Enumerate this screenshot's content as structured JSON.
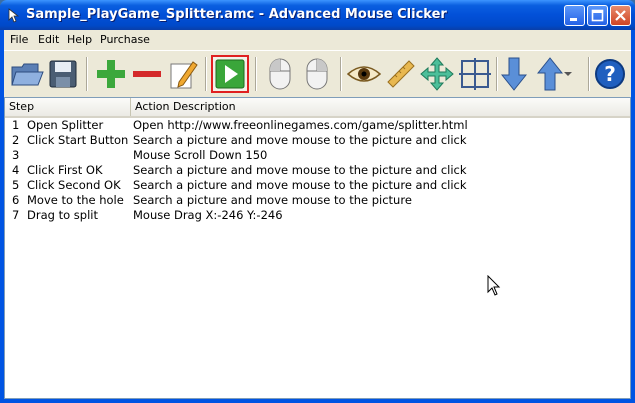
{
  "window": {
    "title": "Sample_PlayGame_Splitter.amc - Advanced Mouse Clicker"
  },
  "menu": [
    "File",
    "Edit",
    "Help",
    "Purchase"
  ],
  "toolbar": {
    "tools": [
      "open-icon",
      "save-icon",
      "add-icon",
      "remove-icon",
      "edit-icon",
      "play-icon",
      "mouse-left-icon",
      "mouse-right-icon",
      "eye-icon",
      "ruler-icon",
      "move-icon",
      "crosshair-icon",
      "down-arrow-icon",
      "up-arrow-icon",
      "dropdown-icon",
      "help-icon"
    ],
    "active_tool": "play-icon"
  },
  "table": {
    "columns": [
      "Step",
      "Action Description"
    ],
    "rows": [
      {
        "num": "1",
        "name": "Open Splitter",
        "desc": "Open http://www.freeonlinegames.com/game/splitter.html"
      },
      {
        "num": "2",
        "name": "Click Start Button",
        "desc": "Search a picture and move mouse to the picture and click"
      },
      {
        "num": "3",
        "name": "",
        "desc": "Mouse Scroll Down 150"
      },
      {
        "num": "4",
        "name": "Click First OK",
        "desc": "Search a picture and move mouse to the picture and click"
      },
      {
        "num": "5",
        "name": "Click Second OK",
        "desc": "Search a picture and move mouse to the picture and click"
      },
      {
        "num": "6",
        "name": "Move to the hole",
        "desc": "Search a picture and move mouse to the picture"
      },
      {
        "num": "7",
        "name": "Drag to split",
        "desc": "Mouse Drag X:-246 Y:-246"
      }
    ]
  }
}
